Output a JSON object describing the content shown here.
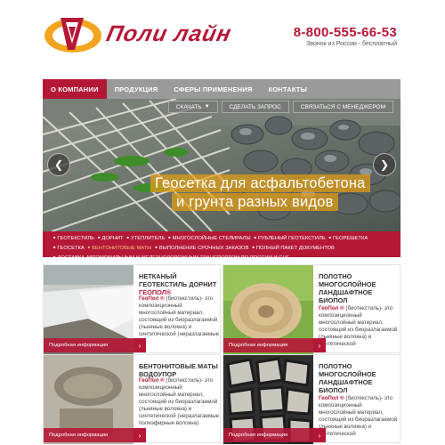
{
  "header": {
    "logo_text": "Поли лайн",
    "phone": "8-800-555-66-53",
    "phone_note": "Звонок из России - бесплатный"
  },
  "nav": [
    {
      "label": "О КОМПАНИИ",
      "active": true
    },
    {
      "label": "ПРОДУКЦИЯ",
      "active": false
    },
    {
      "label": "СФЕРЫ ПРИМЕНЕНИЯ",
      "active": false
    },
    {
      "label": "КОНТАКТЫ",
      "active": false
    }
  ],
  "hero": {
    "buttons": {
      "download": "СКАЧАТЬ",
      "request": "СДЕЛАТЬ ЗАПРОС",
      "manager": "СВЯЗАТЬСЯ С МЕНЕДЖЕРОМ"
    },
    "caption_line1": "Геосетка для асфальтобетона",
    "caption_line2": "и грунта разных видов",
    "prev_icon": "chevron-left-icon",
    "next_icon": "chevron-right-icon"
  },
  "tags": {
    "row1": [
      "ГЕОТЕКСТИЛЬ",
      "ДОРНИТ",
      "УТЕПЛИТЕЛЬ",
      "МНОГОСЛОЙНЫЕ СТЕЛИРАЛЫ",
      "РУБЛЕНЫЙ ГЕОТЕКСТИЛЬ",
      "ГЕОРЕШЕТКА"
    ],
    "row2": [
      "ГЕОСЕТКА",
      "БЕНТОНИТОВЫЕ МАТЫ",
      "ВЫПОЛНЕНИЕ СРОЧНЫХ ЗАКАЗОВ",
      "ПОЛНЫЙ ПАКЕТ ДОКУМЕНТОВ"
    ],
    "row3": [
      "ДОСТАВКА АВТОМОБИЛЬНЫМ И ЖЕЛЕЗНОДОРОЖНЫМ ТРАНСПОРТОМ ПО РОССИИ И СНГ"
    ]
  },
  "cards": [
    {
      "title": "НЕТКАНЫЙ ГЕОТЕКСТИЛЬ ДОРНИТ",
      "subtitle": "ГЕОПОЛ®",
      "brand": "ГеоПол ®",
      "desc": " (биотекстиль)- это композиционный многослойный материал, состоящий из биоразлагаемой (льняные волокна) и синтетической (неразлагаемые",
      "more": "Подробная информация"
    },
    {
      "title": "ПОЛОТНО МНОГОСЛОЙНОЕ ЛАНДШАФТНОЕ БИОПОЛ",
      "subtitle": "",
      "brand": "ГеоПол ®",
      "desc": " (биотекстиль)- это композиционный многослойный материал, состоящий из биоразлагаемой (льняные волокна) и синтетической",
      "more": "Подробная информация"
    },
    {
      "title": "БЕНТОНИТОВЫЕ МАТЫ ВОДОУПОР",
      "subtitle": "",
      "brand": "ГеоПол ®",
      "desc": " (биотекстиль)- это композиционный многослойный материал, состоящий из биоразлагаемой (льняные волокна) и синтетической (неразлагаемые полиэфирные волокна)",
      "more": "Подробная информация"
    },
    {
      "title": "ПОЛОТНО МНОГОСЛОЙНОЕ ЛАНДШАФТНОЕ БИОПОЛ",
      "subtitle": "",
      "brand": "ГеоПол ®",
      "desc": " (биотекстиль)- это композиционный многослойный материал, состоящий из биоразлагаемой (льняные волокна) и синтетической",
      "more": "Подробная информация"
    }
  ]
}
